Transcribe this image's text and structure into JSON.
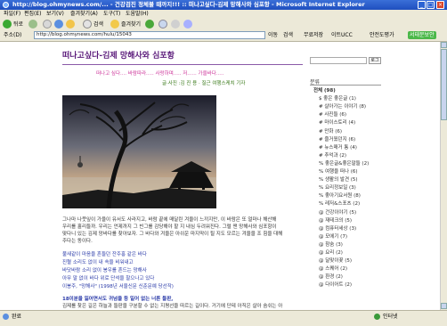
{
  "window": {
    "title": "http://blog.ohmynews.com/... - 건강검진 정체불 때까지!!! :: 떠나고싶다-김제 망해사와 심포항 - Microsoft Internet Explorer"
  },
  "menubar": [
    "파일(F)",
    "편집(E)",
    "보기(V)",
    "즐겨찾기(A)",
    "도구(T)",
    "도움말(H)"
  ],
  "toolbar": {
    "back": "뒤로",
    "search": "검색",
    "favorites": "즐겨찾기",
    "links": "연결"
  },
  "address": {
    "label": "주소(D)",
    "url": "http://blog.ohmynews.com/hulu/15043",
    "go": "이동",
    "ext_search": "검색",
    "ext_free": "무료저장",
    "ext_ucc": "이트UCC",
    "ext_safe": "안전도평가",
    "ext_security": "서태문보안"
  },
  "post": {
    "title": "떠나고싶다-김제 망해사와 심포항",
    "intro_line1": "떠나고 싶다.... 바람따라..... 사랑하며..... 저...... 가을바다.....",
    "intro_line2": "글·사진 :김 진 용 · 질근 여행스케치 기자",
    "caption_lines": [
      "그나마 나뭇잎이 가을이 유서도 사라지고, 바람 끝에 매달린 겨울이 느끼지만, 이 바람은 또 얼마나 해산해",
      "우리를 홀리들까. 우리는 언제까지 그 빈그를 감당해야 할 지 내심 두려워진다. 그럴 땐 망해사와 심포항이",
      "맞다니 있는 김제 망바다를 찾아보자. 그 바다와 겨울은 아쉬운 마지막이 될 지도 모르는 겨울을 조 힘을 대해",
      "주다는 동이다."
    ],
    "poem_lines": [
      "불새같이 마음을 흔들던 잔주홍 같은 바다",
      "진혈 소리도 없이 내 속을 비워내고",
      "바닷바람 소리 없이 봉우를 흔드는 망해사",
      "아무 말 없이 바다 위로 단석을 찰으나고 있다",
      "이봉주, \"망해사\" (1998년 서울신문 신춘문예 당선작)"
    ],
    "bottom_heading": "18이분을 잃어면서도 귀넘을 등 일어 없는 너른 들판,",
    "bottom_line": "김제를 찾은 길은 하늘과 들판을 구분할 수 없는 지평선을 따르는 길이다. 거기에 단테 아직은 살아 숨쉬는 아"
  },
  "sidebar": {
    "search_button": "로그",
    "section_title": "분류",
    "categories": [
      "전체 (98)",
      "$ 좋은 좋은글 (1)",
      "# 살아가는 이야기 (8)",
      "# 사진들 (6)",
      "# 마이스토리 (4)",
      "# 만화 (6)",
      "# 즐거웠던지 (6)",
      "# 뉴스매거 통 (4)",
      "# 추억과 (2)",
      "% 좋은글&좋은말들 (2)",
      "% 여행을 떠나 (6)",
      "% 생활의 발견 (5)",
      "% 요리정보일 (3)",
      "% 좋아기요서원 (8)",
      "% 레저&스포츠 (2)",
      "@ 건강이야기 (5)",
      "@ 재테크의 (5)",
      "@ 컴퓨터세상 (3)",
      "@ 모에기 (7)",
      "@ 참숨 (3)",
      "@ 요리 (2)",
      "@ 달맞이꽃 (5)",
      "@ 스퀘어 (2)",
      "@ 환경 (2)",
      "@ 다이어트 (2)"
    ]
  },
  "status": {
    "left": "완료",
    "right": "인터넷"
  },
  "colors": {
    "titlebar": "#2456c8",
    "chrome": "#ece9d8",
    "post_title": "#5a1a7a",
    "intro": "#cc3399",
    "byline": "#3a7a1a",
    "poem": "#2a3aa8",
    "heading": "#2a3aa8"
  }
}
